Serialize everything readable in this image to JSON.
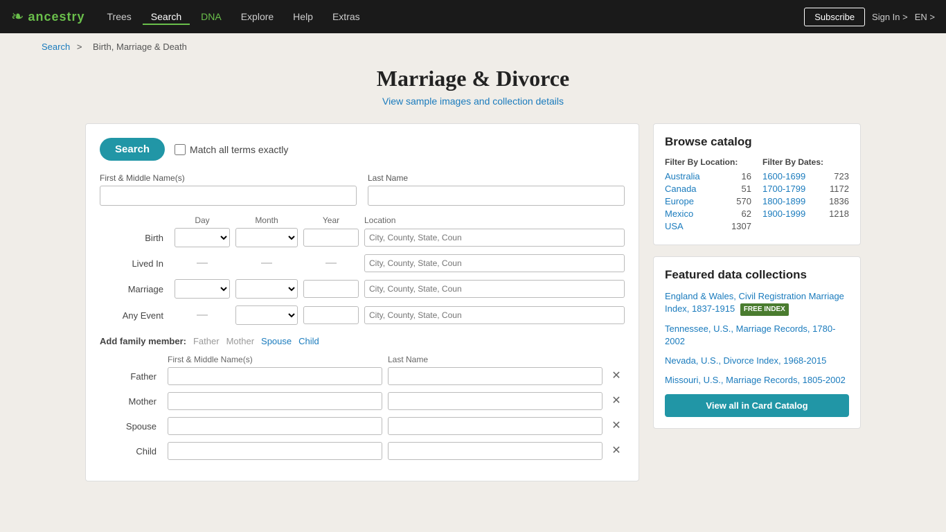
{
  "nav": {
    "logo_leaf": "❧",
    "logo_text": "ancestry",
    "links": [
      {
        "label": "Trees",
        "active": false
      },
      {
        "label": "Search",
        "active": true
      },
      {
        "label": "DNA",
        "active": false,
        "dna": true
      },
      {
        "label": "Explore",
        "active": false
      },
      {
        "label": "Help",
        "active": false
      },
      {
        "label": "Extras",
        "active": false
      }
    ],
    "subscribe_label": "Subscribe",
    "signin_label": "Sign In >",
    "lang_label": "EN >"
  },
  "breadcrumb": {
    "search_label": "Search",
    "separator": ">",
    "current": "Birth, Marriage & Death"
  },
  "page": {
    "title": "Marriage & Divorce",
    "subtitle": "View sample images and collection details"
  },
  "search_form": {
    "search_btn": "Search",
    "match_exact_label": "Match all terms exactly",
    "first_middle_label": "First & Middle Name(s)",
    "last_name_label": "Last Name",
    "first_middle_placeholder": "",
    "last_name_placeholder": "",
    "event_col_day": "Day",
    "event_col_month": "Month",
    "event_col_year": "Year",
    "event_col_location": "Location",
    "events": [
      {
        "label": "Birth",
        "has_selects": true,
        "location_placeholder": "City, County, State, Coun"
      },
      {
        "label": "Lived In",
        "has_selects": false,
        "location_placeholder": "City, County, State, Coun"
      },
      {
        "label": "Marriage",
        "has_selects": true,
        "location_placeholder": "City, County, State, Coun"
      },
      {
        "label": "Any Event",
        "has_selects_month_year": true,
        "location_placeholder": "City, County, State, Coun"
      }
    ],
    "add_family_label": "Add family member:",
    "family_links": [
      {
        "label": "Father",
        "active": false
      },
      {
        "label": "Mother",
        "active": false
      },
      {
        "label": "Spouse",
        "active": true
      },
      {
        "label": "Child",
        "active": true
      }
    ],
    "family_col_first": "First & Middle Name(s)",
    "family_col_last": "Last Name",
    "family_members": [
      {
        "label": "Father"
      },
      {
        "label": "Mother"
      },
      {
        "label": "Spouse"
      },
      {
        "label": "Child"
      }
    ]
  },
  "browse_catalog": {
    "title": "Browse catalog",
    "location_header": "Filter By Location:",
    "dates_header": "Filter By Dates:",
    "locations": [
      {
        "label": "Australia",
        "count": 16
      },
      {
        "label": "Canada",
        "count": 51
      },
      {
        "label": "Europe",
        "count": 570
      },
      {
        "label": "Mexico",
        "count": 62
      },
      {
        "label": "USA",
        "count": 1307
      }
    ],
    "date_ranges": [
      {
        "label": "1600-1699",
        "count": 723
      },
      {
        "label": "1700-1799",
        "count": 1172
      },
      {
        "label": "1800-1899",
        "count": 1836
      },
      {
        "label": "1900-1999",
        "count": 1218
      }
    ]
  },
  "featured": {
    "title": "Featured data collections",
    "collections": [
      {
        "label": "England & Wales, Civil Registration Marriage Index, 1837-1915",
        "free": true,
        "free_badge": "FREE INDEX"
      },
      {
        "label": "Tennessee, U.S., Marriage Records, 1780-2002",
        "free": false
      },
      {
        "label": "Nevada, U.S., Divorce Index, 1968-2015",
        "free": false
      },
      {
        "label": "Missouri, U.S., Marriage Records, 1805-2002",
        "free": false
      }
    ],
    "card_catalog_btn": "View all in Card Catalog"
  }
}
